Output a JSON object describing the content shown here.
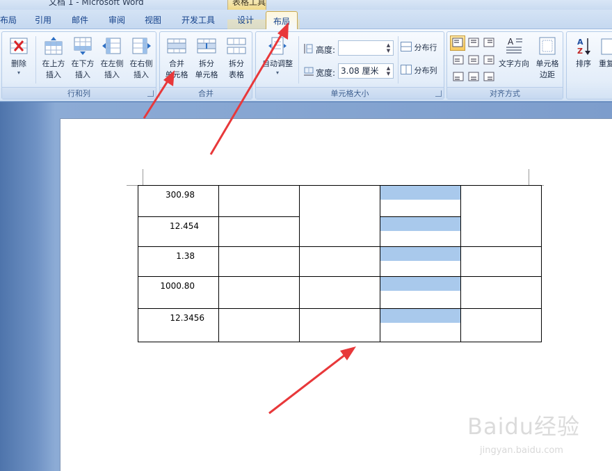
{
  "window": {
    "title": "文档 1 - Microsoft Word",
    "context_tab_group": "表格工具"
  },
  "tabs": [
    {
      "label": "布局"
    },
    {
      "label": "引用"
    },
    {
      "label": "邮件"
    },
    {
      "label": "审阅"
    },
    {
      "label": "视图"
    },
    {
      "label": "开发工具"
    },
    {
      "label": "设计"
    },
    {
      "label": "布局",
      "active": true
    }
  ],
  "ribbon": {
    "rows_cols": {
      "label": "行和列",
      "delete": "删除",
      "insert_above": [
        "在上方",
        "插入"
      ],
      "insert_below": [
        "在下方",
        "插入"
      ],
      "insert_left": [
        "在左侧",
        "插入"
      ],
      "insert_right": [
        "在右侧",
        "插入"
      ]
    },
    "merge": {
      "label": "合并",
      "merge_cells": [
        "合并",
        "单元格"
      ],
      "split_cells": [
        "拆分",
        "单元格"
      ],
      "split_table": [
        "拆分",
        "表格"
      ]
    },
    "cell_size": {
      "label": "单元格大小",
      "autofit": "自动调整",
      "height_label": "高度:",
      "height_value": "",
      "width_label": "宽度:",
      "width_value": "3.08 厘米",
      "distribute_rows": "分布行",
      "distribute_cols": "分布列"
    },
    "alignment": {
      "label": "对齐方式",
      "text_direction": "文字方向",
      "cell_margins": [
        "单元格",
        "边距"
      ]
    },
    "data": {
      "sort": "排序",
      "repeat": "重复"
    }
  },
  "table": {
    "values": [
      "300.98",
      "12.454",
      "1.38",
      "1000.80",
      "12.3456"
    ]
  },
  "watermark": {
    "brand": "Baidu经验",
    "url": "jingyan.baidu.com"
  },
  "colors": {
    "accent": "#e8383a",
    "highlight": "#a9c9ec",
    "tab_text": "#15428b"
  }
}
